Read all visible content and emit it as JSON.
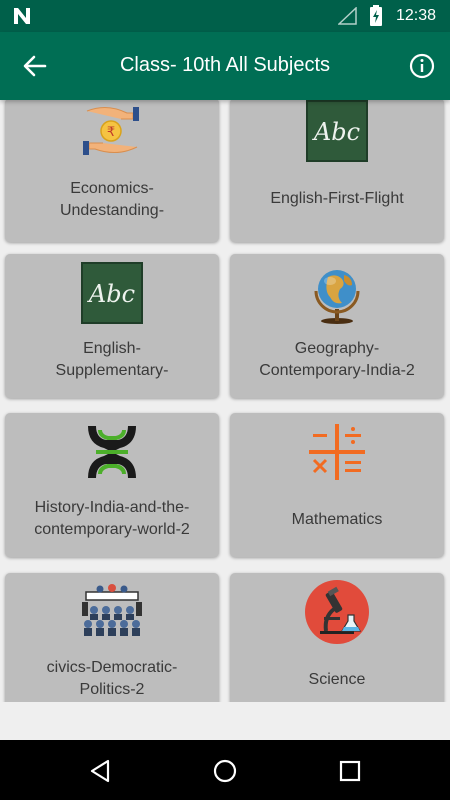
{
  "status_bar": {
    "time": "12:38"
  },
  "app_bar": {
    "title": "Class- 10th All Subjects"
  },
  "subjects": [
    {
      "label": "Economics-\nUndestanding-",
      "icon": "money-hands-icon"
    },
    {
      "label": "English-First-Flight",
      "icon": "abc-chalkboard-icon"
    },
    {
      "label": "English-\nSupplementary-",
      "icon": "abc-chalkboard-icon"
    },
    {
      "label": "Geography-\nContemporary-India-2",
      "icon": "globe-icon"
    },
    {
      "label": "History-India-and-the-\ncontemporary-world-2",
      "icon": "figure-symbol-icon"
    },
    {
      "label": "Mathematics",
      "icon": "math-operators-icon"
    },
    {
      "label": "civics-Democratic-\nPolitics-2",
      "icon": "parliament-icon"
    },
    {
      "label": "Science",
      "icon": "microscope-icon"
    }
  ],
  "colors": {
    "status_bar": "#00604a",
    "app_bar": "#006e54",
    "card": "#bdbdbd",
    "math_orange": "#f26b21"
  }
}
